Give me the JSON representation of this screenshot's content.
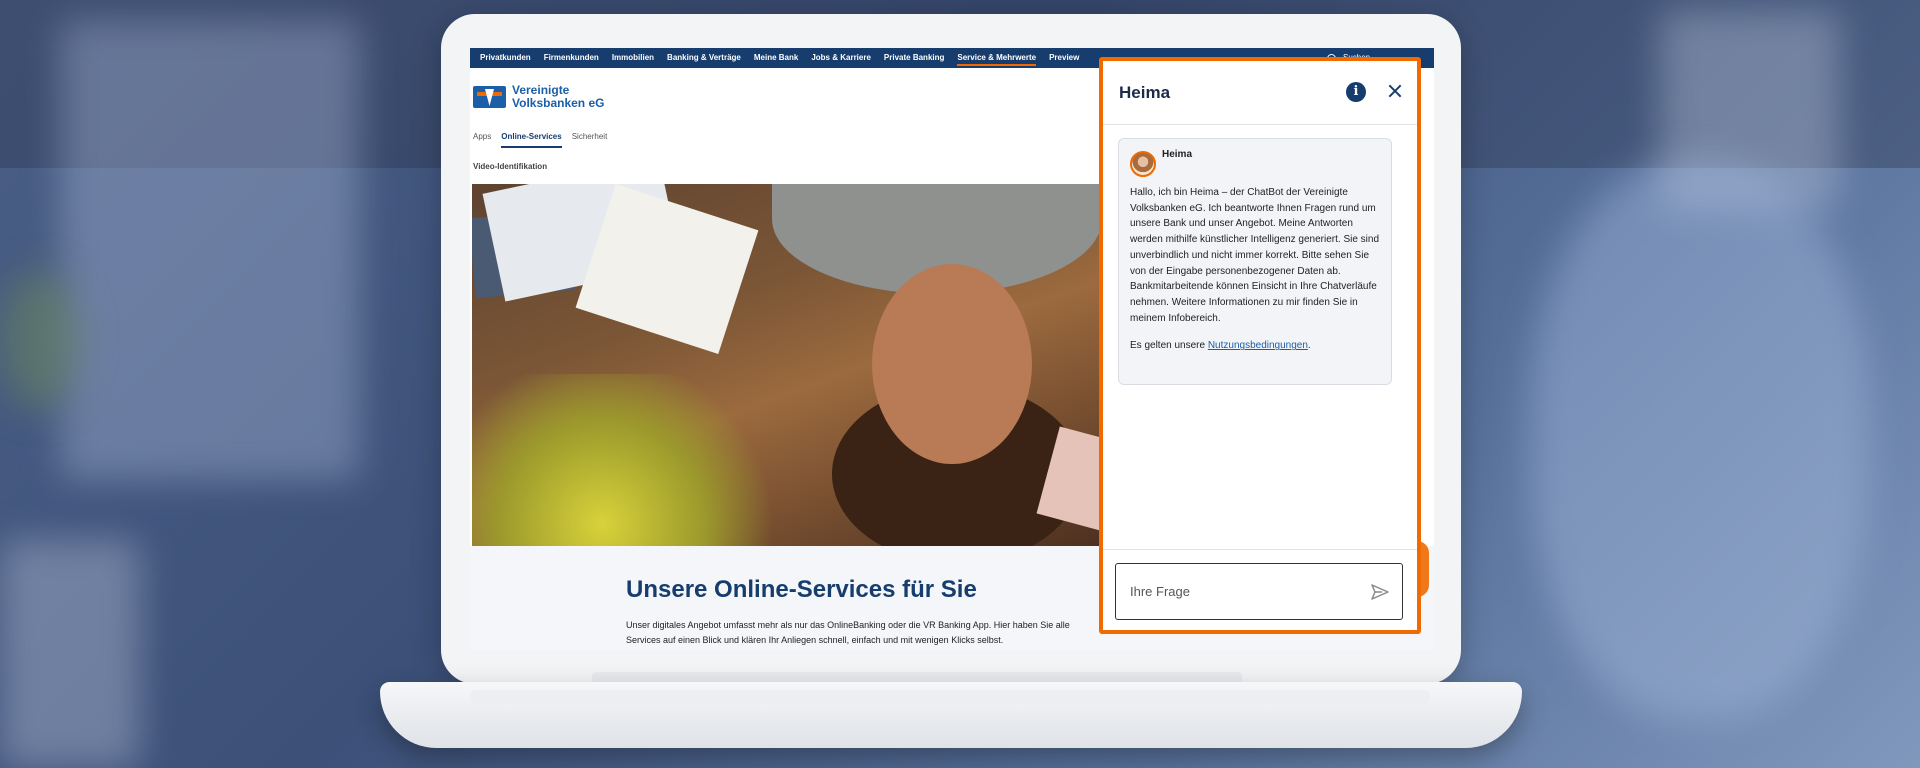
{
  "site": {
    "topnav": [
      "Privatkunden",
      "Firmenkunden",
      "Immobilien",
      "Banking & Verträge",
      "Meine Bank",
      "Jobs & Karriere",
      "Private Banking",
      "Service & Mehrwerte",
      "Preview"
    ],
    "topnav_active": "Service & Mehrwerte",
    "search_label": "Suchen",
    "logo_line1": "Vereinigte",
    "logo_line2": "Volksbanken eG",
    "subnav": [
      "Apps",
      "Online-Services",
      "Sicherheit"
    ],
    "subnav_active": "Online-Services",
    "subnav2": "Video-Identifikation",
    "content_title": "Unsere Online-Services für Sie",
    "content_text": "Unser digitales Angebot umfasst mehr als nur das OnlineBanking oder die VR Banking App. Hier haben Sie alle Services auf einen Blick und klären Ihr Anliegen schnell, einfach und mit wenigen Klicks selbst."
  },
  "chat": {
    "title": "Heima",
    "info_icon": "info-icon",
    "close_icon": "close-icon",
    "message": {
      "sender": "Heima",
      "text": "Hallo, ich bin Heima – der ChatBot der Vereinigte Volksbanken eG. Ich beantworte Ihnen Fragen rund um unsere Bank und unser Angebot. Meine Antworten werden mithilfe künstlicher Intelligenz generiert. Sie sind unverbindlich und nicht immer korrekt. Bitte sehen Sie von der Eingabe personenbezogener Daten ab. Bankmitarbeitende können Einsicht in Ihre Chatverläufe nehmen. Weitere Informationen zu mir finden Sie in meinem Infobereich.",
      "terms_prefix": "Es gelten unsere ",
      "terms_link": "Nutzungsbedingungen",
      "terms_suffix": "."
    },
    "input_placeholder": "Ihre Frage",
    "send_icon": "send-icon"
  },
  "colors": {
    "brand_blue": "#163d6e",
    "accent_orange": "#f06a00",
    "link_blue": "#1a5fa8"
  }
}
